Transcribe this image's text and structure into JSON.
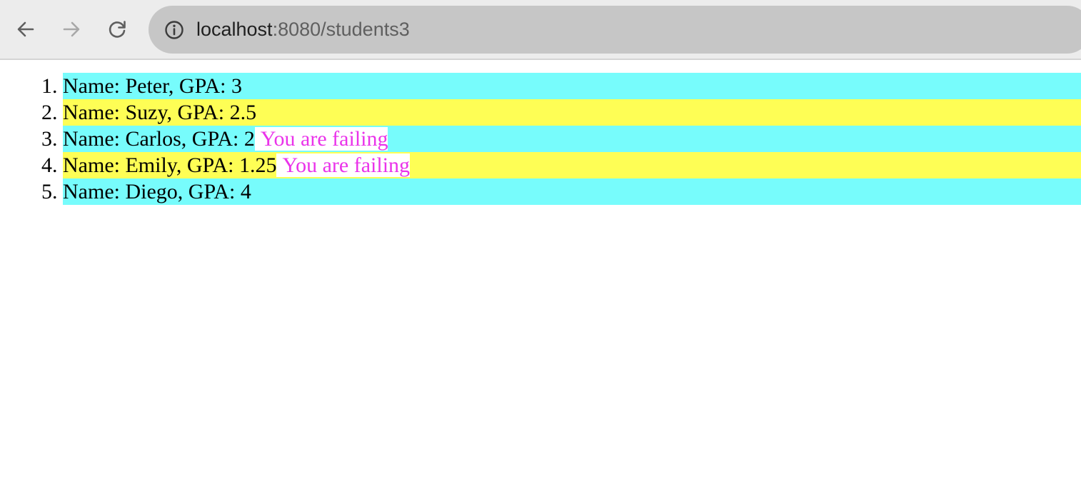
{
  "browser": {
    "url_host": "localhost",
    "url_rest": ":8080/students3",
    "icons": {
      "back": "arrow-left-icon",
      "forward": "arrow-right-icon",
      "reload": "reload-icon",
      "info": "info-icon"
    }
  },
  "students": [
    {
      "number": "1.",
      "text": "Name: Peter, GPA: 3",
      "warning": "",
      "row_color": "#77fcfc"
    },
    {
      "number": "2.",
      "text": "Name: Suzy, GPA: 2.5",
      "warning": "",
      "row_color": "#fefe55"
    },
    {
      "number": "3.",
      "text": "Name: Carlos, GPA: 2",
      "warning": "You are failing",
      "row_color": "#77fcfc"
    },
    {
      "number": "4.",
      "text": "Name: Emily, GPA: 1.25",
      "warning": "You are failing",
      "row_color": "#fefe55"
    },
    {
      "number": "5.",
      "text": "Name: Diego, GPA: 4",
      "warning": "",
      "row_color": "#77fcfc"
    }
  ],
  "colors": {
    "warning_text": "#ea33ea",
    "cyan_row": "#77fcfc",
    "yellow_row": "#fefe55"
  }
}
